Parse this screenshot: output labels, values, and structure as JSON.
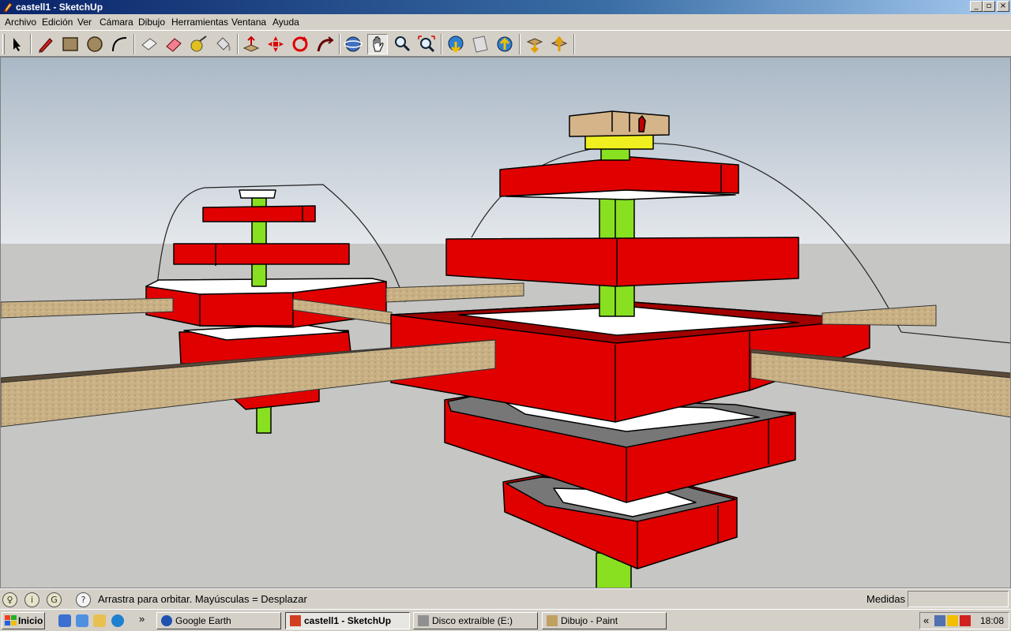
{
  "window": {
    "title": "castell1 - SketchUp"
  },
  "menu": [
    "Archivo",
    "Edición",
    "Ver",
    "Cámara",
    "Dibujo",
    "Herramientas",
    "Ventana",
    "Ayuda"
  ],
  "toolbar": {
    "tools": [
      "select",
      "pencil",
      "rectangle",
      "circle",
      "arc",
      "eraser-box",
      "eraser",
      "tape-measure",
      "paint-bucket",
      "push-pull",
      "move",
      "rotate",
      "follow-me",
      "orbit",
      "pan",
      "zoom",
      "zoom-extents",
      "previous-view",
      "next-view",
      "get-models",
      "share-model",
      "import",
      "export"
    ],
    "active_tool": "pan"
  },
  "status": {
    "message": "Arrastra para orbitar.  Mayúsculas = Desplazar",
    "measures_label": "Medidas",
    "measures_value": ""
  },
  "taskbar": {
    "start_label": "Inicio",
    "tasks": [
      {
        "label": "Google Earth",
        "pressed": false
      },
      {
        "label": "castell1 - SketchUp",
        "pressed": true
      },
      {
        "label": "Disco extraíble (E:)",
        "pressed": false
      },
      {
        "label": "Dibujo - Paint",
        "pressed": false
      }
    ],
    "chevron": "»",
    "tray_chevron": "«",
    "clock": "18:08"
  },
  "colors": {
    "sky_top": "#aab8c6",
    "sky_bottom": "#e4e8ec",
    "ground": "#c6c6c4",
    "red": "#e00000",
    "green": "#88e020",
    "wood": "#c8b084",
    "grey_frame": "#777777"
  }
}
